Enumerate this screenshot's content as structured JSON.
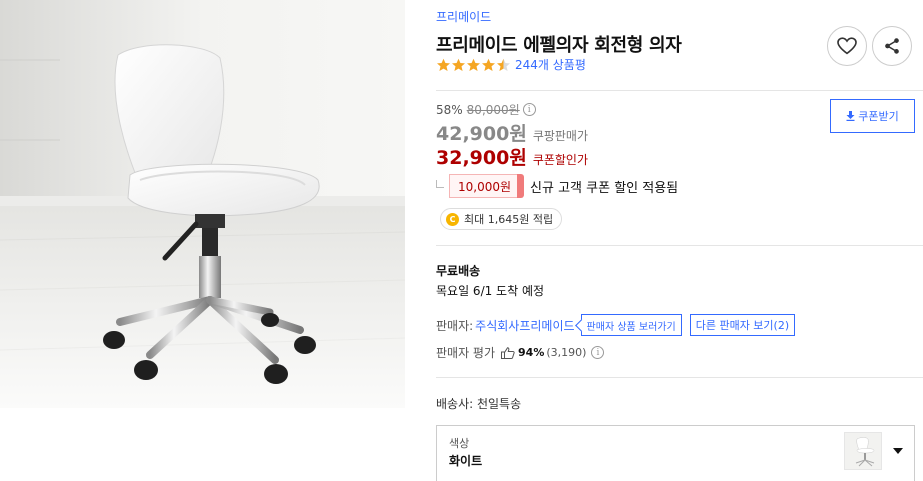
{
  "product": {
    "brand": "프리메이드",
    "title": "프리메이드 에펠의자 회전형 의자",
    "rating": 4.5,
    "review_count": "244개 상품평"
  },
  "actions": {
    "like": "heart-icon",
    "share": "share-icon"
  },
  "pricing": {
    "discount_rate": "58%",
    "original_price": "80,000원",
    "info_icon": "i",
    "sale_price": "42,900원",
    "sale_label": "쿠팡판매가",
    "coupon_price": "32,900원",
    "coupon_label": "쿠폰할인가",
    "coupon_button": "쿠폰받기",
    "new_coupon_amount": "10,000원",
    "new_coupon_text": "신규 고객 쿠폰 할인 적용됨",
    "reward_coin": "C",
    "reward_text": "최대 1,645원 적립"
  },
  "shipping": {
    "title": "무료배송",
    "date": "목요일 6/1 도착 예정"
  },
  "seller": {
    "label": "판매자:",
    "name": "주식회사프리메이드",
    "view_products": "판매자 상품 보러가기",
    "other_sellers": "다른 판매자 보기(2)",
    "eval_label": "판매자 평가",
    "eval_percent": "94%",
    "eval_count": "(3,190)"
  },
  "carrier": "배송사: 천일특송",
  "option": {
    "label": "색상",
    "value": "화이트"
  },
  "colors": {
    "accent": "#346aff",
    "price_red": "#ae0000",
    "star": "#f5a623"
  }
}
